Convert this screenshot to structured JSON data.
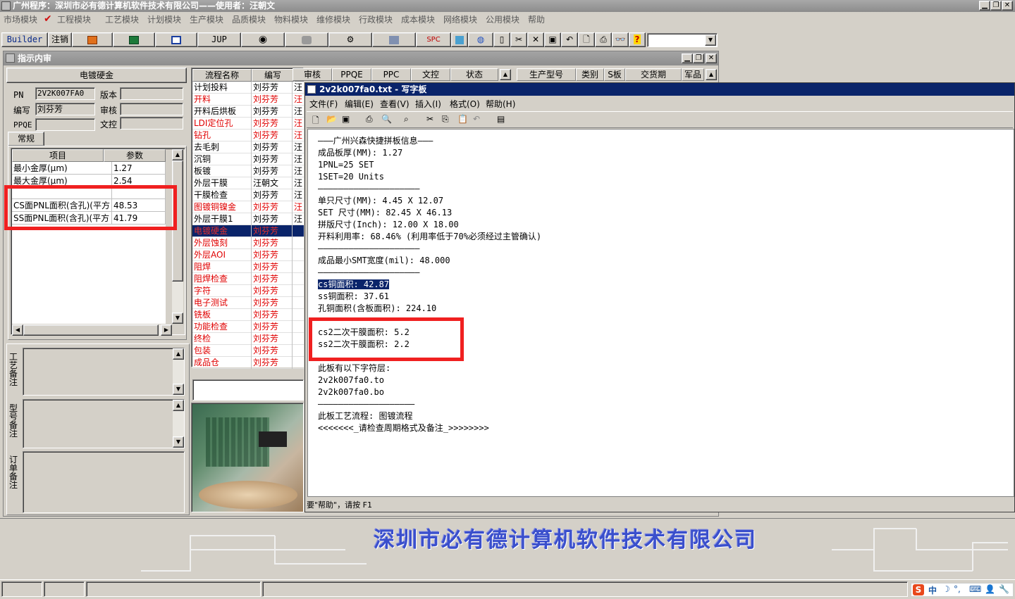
{
  "window": {
    "title": "广州程序：深圳市必有德计算机软件技术有限公司——使用者：汪朝文"
  },
  "menu": [
    "市场模块",
    "工程模块",
    "工艺模块",
    "计划模块",
    "生产模块",
    "品质模块",
    "物料模块",
    "维修模块",
    "行政模块",
    "成本模块",
    "网络模块",
    "公用模块",
    "帮助"
  ],
  "toolbar": {
    "builder": "Builder",
    "logout": "注销",
    "jup": "JUP",
    "spc": "SPC"
  },
  "instruction": {
    "title": "指示内审",
    "header": "电镀硬金",
    "fields": {
      "pn_label": "PN",
      "pn": "2V2K007FA0",
      "version_label": "版本",
      "writer_label": "编写",
      "writer": "刘芬芳",
      "review_label": "审核",
      "pfqe_label": "PPQE",
      "text_label": "文控"
    },
    "tab": "常规",
    "param_headers": [
      "项目",
      "参数"
    ],
    "params": [
      [
        "最小金厚(μm)",
        "1.27"
      ],
      [
        "最大金厚(μm)",
        "2.54"
      ],
      [
        "CS面PNL面积(含孔)(平方",
        "48.53"
      ],
      [
        "SS面PNL面积(含孔)(平方",
        "41.79"
      ]
    ],
    "notes": [
      [
        "工",
        "艺",
        "备",
        "注"
      ],
      [
        "型",
        "号",
        "备",
        "注"
      ],
      [
        "订",
        "单",
        "备",
        "注"
      ]
    ]
  },
  "process_table": {
    "headers": [
      "流程名称",
      "编写",
      "审核",
      "PPQE",
      "PPC",
      "文控",
      "状态"
    ],
    "rows": [
      {
        "name": "计划投料",
        "writer": "刘芬芳",
        "flag": "汪",
        "red": false
      },
      {
        "name": "开料",
        "writer": "刘芬芳",
        "flag": "汪",
        "red": true
      },
      {
        "name": "开料后烘板",
        "writer": "刘芬芳",
        "flag": "汪",
        "red": false
      },
      {
        "name": "LDI定位孔",
        "writer": "刘芬芳",
        "flag": "汪",
        "red": true
      },
      {
        "name": "钻孔",
        "writer": "刘芬芳",
        "flag": "汪",
        "red": true
      },
      {
        "name": "去毛刺",
        "writer": "刘芬芳",
        "flag": "汪",
        "red": false
      },
      {
        "name": "沉铜",
        "writer": "刘芬芳",
        "flag": "汪",
        "red": false
      },
      {
        "name": "板镀",
        "writer": "刘芬芳",
        "flag": "汪",
        "red": false
      },
      {
        "name": "外层干膜",
        "writer": "汪朝文",
        "flag": "汪",
        "red": false
      },
      {
        "name": "干膜检查",
        "writer": "刘芬芳",
        "flag": "汪",
        "red": false
      },
      {
        "name": "图镀铜镍金",
        "writer": "刘芬芳",
        "flag": "汪",
        "red": true
      },
      {
        "name": "外层干膜1",
        "writer": "刘芬芳",
        "flag": "汪",
        "red": false
      },
      {
        "name": "电镀硬金",
        "writer": "刘芬芳",
        "flag": "",
        "red": true,
        "selected": true
      },
      {
        "name": "外层蚀刻",
        "writer": "刘芬芳",
        "flag": "",
        "red": true
      },
      {
        "name": "外层AOI",
        "writer": "刘芬芳",
        "flag": "",
        "red": true
      },
      {
        "name": "阻焊",
        "writer": "刘芬芳",
        "flag": "",
        "red": true
      },
      {
        "name": "阻焊检查",
        "writer": "刘芬芳",
        "flag": "",
        "red": true
      },
      {
        "name": "字符",
        "writer": "刘芬芳",
        "flag": "",
        "red": true
      },
      {
        "name": "电子测试",
        "writer": "刘芬芳",
        "flag": "",
        "red": true
      },
      {
        "name": "铣板",
        "writer": "刘芬芳",
        "flag": "",
        "red": true
      },
      {
        "name": "功能检查",
        "writer": "刘芬芳",
        "flag": "",
        "red": true
      },
      {
        "name": "终检",
        "writer": "刘芬芳",
        "flag": "",
        "red": true
      },
      {
        "name": "包装",
        "writer": "刘芬芳",
        "flag": "",
        "red": true
      },
      {
        "name": "成品仓",
        "writer": "刘芬芳",
        "flag": "",
        "red": true
      }
    ]
  },
  "right_table": {
    "headers": [
      "生产型号",
      "类别",
      "S板",
      "交货期",
      "军品"
    ]
  },
  "wordpad": {
    "title": "2v2k007fa0.txt - 写字板",
    "menu": [
      "文件(F)",
      "编辑(E)",
      "查看(V)",
      "插入(I)",
      "格式(O)",
      "帮助(H)"
    ],
    "lines": [
      "———广州兴森快捷拼板信息———",
      "成品板厚(MM): 1.27",
      "1PNL=25 SET",
      "1SET=20 Units",
      "————————————————————",
      "单只尺寸(MM): 4.45 X 12.07",
      "SET 尺寸(MM): 82.45 X 46.13",
      "拼版尺寸(Inch): 12.00 X 18.00",
      "开料利用率: 68.46% (利用率低于70%必须经过主管确认)",
      "————————————————————",
      "成品最小SMT宽度(mil): 48.000",
      "————————————————————",
      "cs铜面积: 42.87",
      "ss铜面积: 37.61",
      "孔铜面积(含板面积): 224.10",
      "",
      "cs2二次干膜面积: 5.2",
      "ss2二次干膜面积: 2.2",
      "",
      "此板有以下字符层:",
      "2v2k007fa0.to",
      "2v2k007fa0.bo",
      "———————————————————",
      "此板工艺流程: 图镀流程",
      "<<<<<<<_请检查周期格式及备注_>>>>>>>>"
    ],
    "status": "要\"帮助\"，请按 F1"
  },
  "company_banner": "深圳市必有德计算机软件技术有限公司",
  "tray": {
    "ime": "中"
  }
}
